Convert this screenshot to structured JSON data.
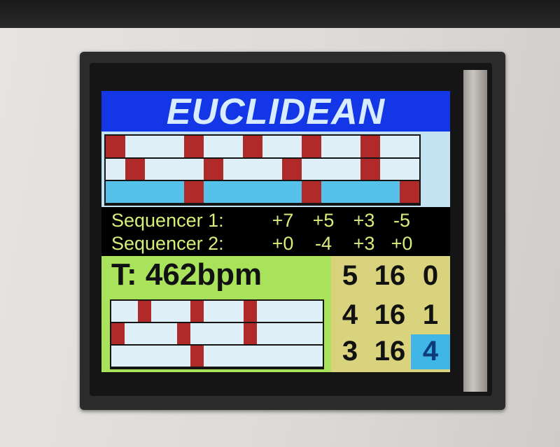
{
  "title": "EUCLIDEAN",
  "colors": {
    "title_bg": "#1337e6",
    "title_text": "#d8ecff",
    "hit": "#b02a2a",
    "rest": "#dfeff7",
    "rest_alt": "#56c2ea",
    "top_panel_bg": "#c3e3f3",
    "tempo_panel_bg": "#a9e35c",
    "params_panel_bg": "#d8d37c",
    "sequencer_text": "#d6ee7a",
    "active_param_bg": "#3fb6e6"
  },
  "top_patterns": [
    {
      "steps": 16,
      "hits": [
        0,
        4,
        7,
        10,
        13
      ],
      "rest_color": "rest"
    },
    {
      "steps": 16,
      "hits": [
        1,
        5,
        9,
        13
      ],
      "rest_color": "rest"
    },
    {
      "steps": 16,
      "hits": [
        4,
        10,
        15
      ],
      "rest_color": "rest_alt"
    }
  ],
  "sequencers": [
    {
      "label": "Sequencer 1:",
      "values": [
        "+7",
        "+5",
        "+3",
        "-5"
      ]
    },
    {
      "label": "Sequencer 2:",
      "values": [
        "+0",
        "-4",
        "+3",
        "+0"
      ]
    }
  ],
  "tempo": {
    "text": "T: 462bpm"
  },
  "bottom_patterns": [
    {
      "steps": 16,
      "hits": [
        2,
        6,
        10
      ],
      "rest_color": "rest"
    },
    {
      "steps": 16,
      "hits": [
        0,
        5,
        10
      ],
      "rest_color": "rest"
    },
    {
      "steps": 16,
      "hits": [
        6
      ],
      "rest_color": "rest"
    }
  ],
  "params": [
    [
      "5",
      "16",
      "0"
    ],
    [
      "4",
      "16",
      "1"
    ],
    [
      "3",
      "16",
      "4"
    ]
  ],
  "active_param": {
    "row": 2,
    "col": 2
  }
}
